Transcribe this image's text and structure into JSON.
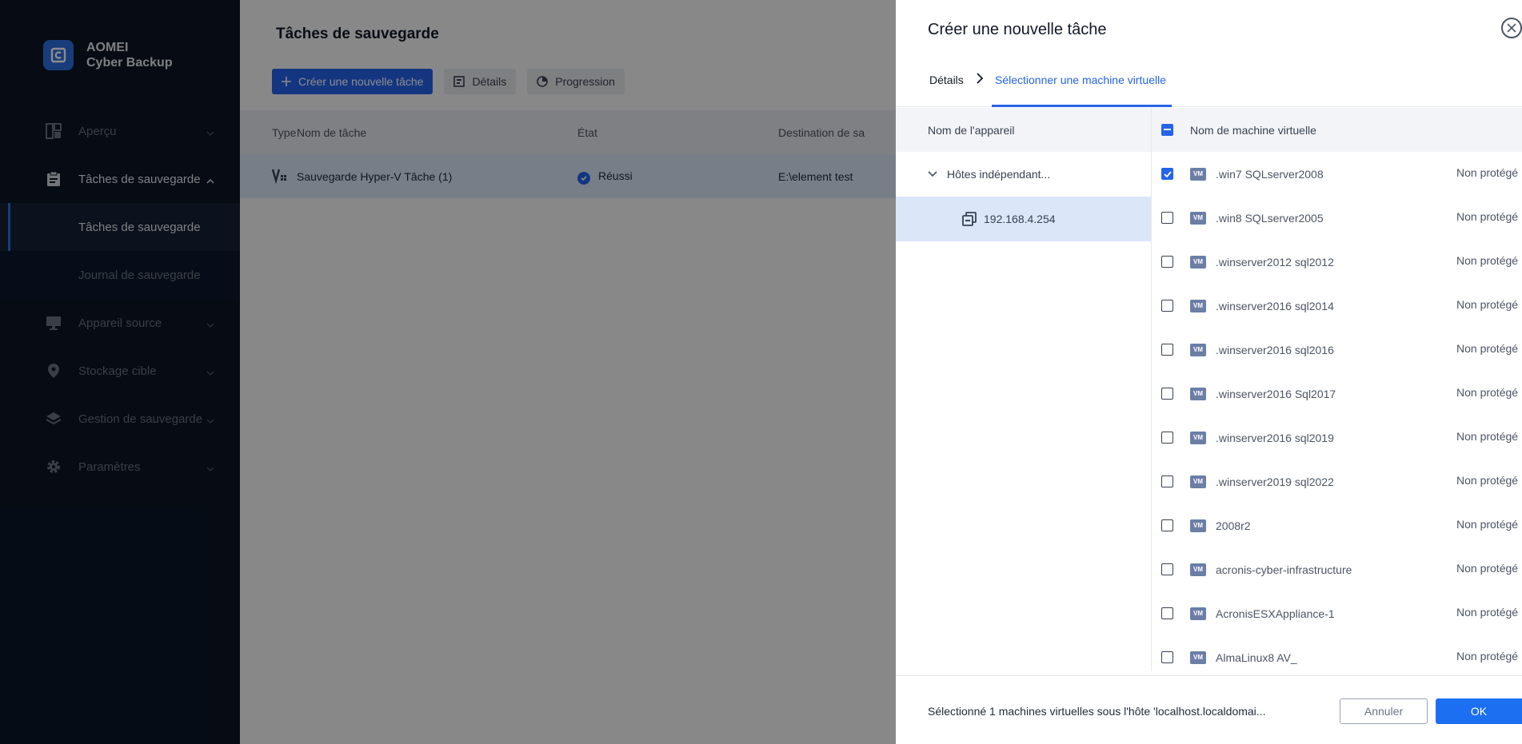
{
  "brand": {
    "line1": "AOMEI",
    "line2": "Cyber Backup",
    "logo_icon": "aomei-logo-icon"
  },
  "sidebar": {
    "items": [
      {
        "label": "Aperçu",
        "icon": "dashboard-icon"
      },
      {
        "label": "Tâches de sauvegarde",
        "icon": "clipboard-icon",
        "expanded": true
      },
      {
        "label": "Appareil source",
        "icon": "monitor-icon"
      },
      {
        "label": "Stockage cible",
        "icon": "location-pin-icon"
      },
      {
        "label": "Gestion de sauvegarde",
        "icon": "layers-icon"
      },
      {
        "label": "Paramètres",
        "icon": "gear-icon"
      }
    ],
    "subitems": [
      {
        "label": "Tâches de sauvegarde",
        "current": true
      },
      {
        "label": "Journal de sauvegarde",
        "current": false
      }
    ]
  },
  "main": {
    "title": "Tâches de sauvegarde",
    "toolbar": {
      "create_label": "Créer une nouvelle tâche",
      "details_label": "Détails",
      "progress_label": "Progression"
    },
    "table": {
      "headers": [
        "Type",
        "Nom de tâche",
        "État",
        "Destination de sa"
      ],
      "rows": [
        {
          "name": "Sauvegarde Hyper-V Tâche (1)",
          "state": "Réussi",
          "destination": "E:\\element test"
        }
      ]
    }
  },
  "drawer": {
    "title": "Créer une nouvelle tâche",
    "steps": {
      "step1": "Détails",
      "step2": "Sélectionner une machine virtuelle"
    },
    "left": {
      "header": "Nom de l'appareil",
      "node": "Hôtes indépendant...",
      "leaf": "192.168.4.254"
    },
    "right": {
      "header": "Nom de machine virtuelle",
      "badge": "VM",
      "vms": [
        {
          "name": ".win7 SQLserver2008",
          "status": "Non protégé",
          "checked": true
        },
        {
          "name": ".win8 SQLserver2005",
          "status": "Non protégé",
          "checked": false
        },
        {
          "name": ".winserver2012 sql2012",
          "status": "Non protégé",
          "checked": false
        },
        {
          "name": ".winserver2016 sql2014",
          "status": "Non protégé",
          "checked": false
        },
        {
          "name": ".winserver2016 sql2016",
          "status": "Non protégé",
          "checked": false
        },
        {
          "name": ".winserver2016 Sql2017",
          "status": "Non protégé",
          "checked": false
        },
        {
          "name": ".winserver2016 sql2019",
          "status": "Non protégé",
          "checked": false
        },
        {
          "name": ".winserver2019 sql2022",
          "status": "Non protégé",
          "checked": false
        },
        {
          "name": "2008r2",
          "status": "Non protégé",
          "checked": false
        },
        {
          "name": "acronis-cyber-infrastructure",
          "status": "Non protégé",
          "checked": false
        },
        {
          "name": "AcronisESXAppliance-1",
          "status": "Non protégé",
          "checked": false
        },
        {
          "name": "AlmaLinux8 AV_",
          "status": "Non protégé",
          "checked": false
        }
      ]
    },
    "footer": {
      "summary": "Sélectionné 1 machines virtuelles sous l'hôte 'localhost.localdomai...",
      "cancel_label": "Annuler",
      "ok_label": "OK"
    }
  },
  "colors": {
    "accent": "#2563eb",
    "sidebar_bg": "#0b1526",
    "selected_row": "#dbe6f8"
  }
}
